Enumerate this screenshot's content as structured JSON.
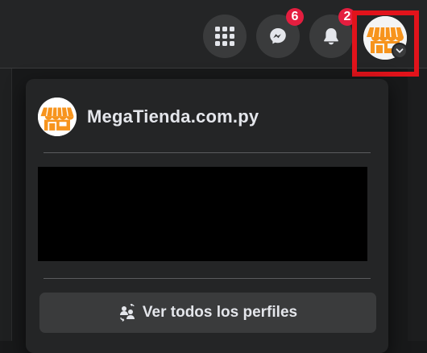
{
  "header": {
    "messenger_badge": "6",
    "notifications_badge": "2"
  },
  "account_menu": {
    "profile_name": "MegaTienda.com.py",
    "see_all_profiles_label": "Ver todos los perfiles"
  },
  "colors": {
    "background": "#18191a",
    "surface": "#242526",
    "button": "#3a3b3c",
    "badge": "#e41e3f",
    "highlight_box": "#e2131b",
    "avatar_orange": "#f7941d"
  },
  "icons": {
    "apps": "grid-icon",
    "messenger": "messenger-icon",
    "notifications": "bell-icon",
    "account": "store-icon",
    "account_menu_toggle": "chevron-down-icon",
    "see_all_profiles": "switch-profiles-icon"
  }
}
